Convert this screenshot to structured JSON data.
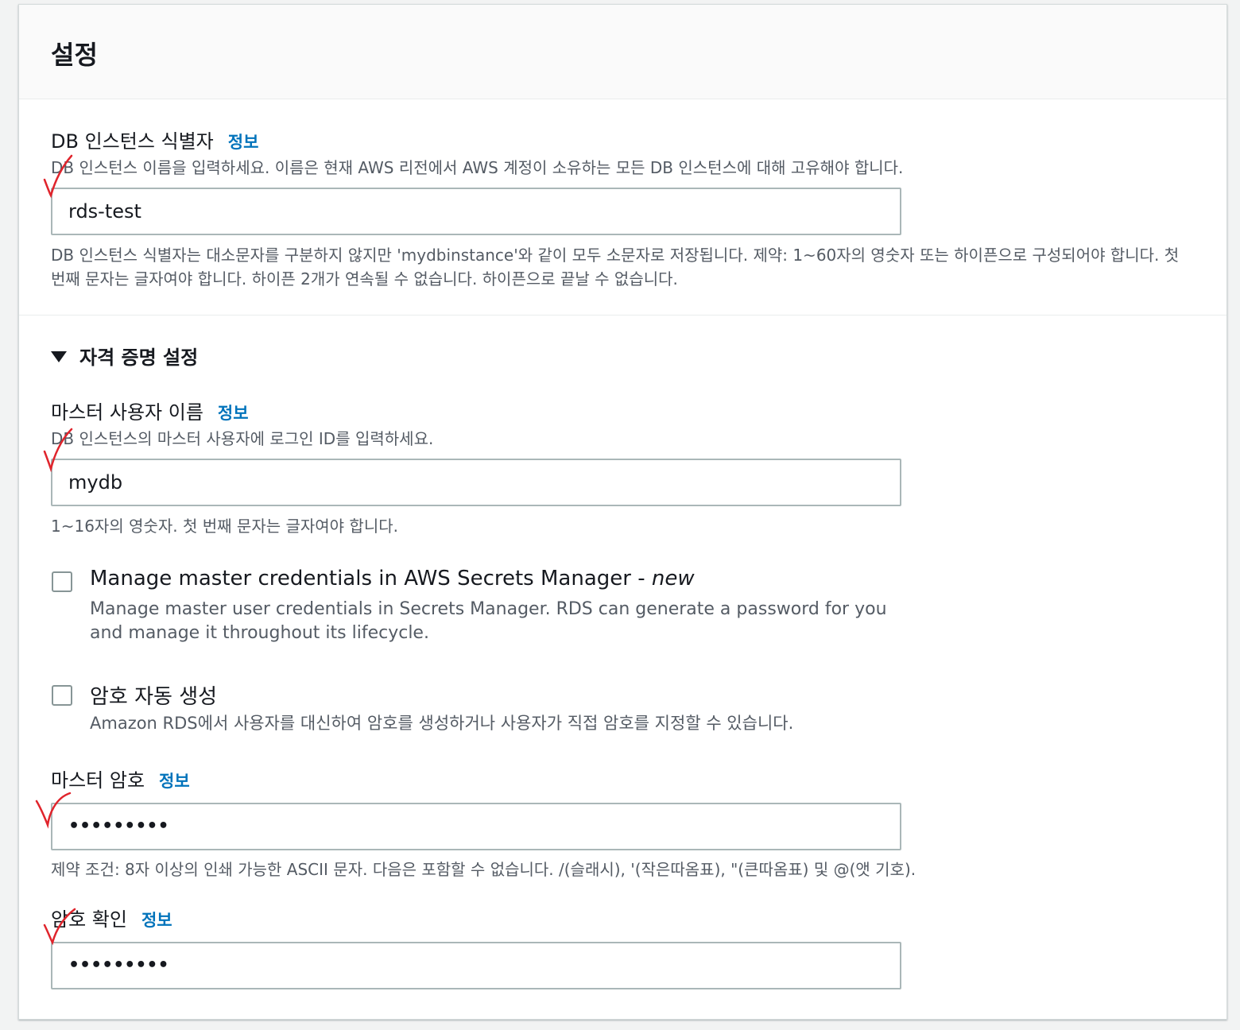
{
  "panel": {
    "title": "설정"
  },
  "db_identifier": {
    "label": "DB 인스턴스 식별자",
    "info": "정보",
    "description": "DB 인스턴스 이름을 입력하세요. 이름은 현재 AWS 리전에서 AWS 계정이 소유하는 모든 DB 인스턴스에 대해 고유해야 합니다.",
    "value": "rds-test",
    "constraint": "DB 인스턴스 식별자는 대소문자를 구분하지 않지만 'mydbinstance'와 같이 모두 소문자로 저장됩니다. 제약: 1~60자의 영숫자 또는 하이픈으로 구성되어야 합니다. 첫 번째 문자는 글자여야 합니다. 하이픈 2개가 연속될 수 없습니다. 하이픈으로 끝날 수 없습니다."
  },
  "credentials": {
    "section_title": "자격 증명 설정",
    "master_username": {
      "label": "마스터 사용자 이름",
      "info": "정보",
      "description": "DB 인스턴스의 마스터 사용자에 로그인 ID를 입력하세요.",
      "value": "mydb",
      "constraint": "1~16자의 영숫자. 첫 번째 문자는 글자여야 합니다."
    },
    "secrets_manager": {
      "label_main": "Manage master credentials in AWS Secrets Manager - ",
      "label_new": "new",
      "description": "Manage master user credentials in Secrets Manager. RDS can generate a password for you and manage it throughout its lifecycle.",
      "checked": false
    },
    "auto_password": {
      "label": "암호 자동 생성",
      "description": "Amazon RDS에서 사용자를 대신하여 암호를 생성하거나 사용자가 직접 암호를 지정할 수 있습니다.",
      "checked": false
    },
    "master_password": {
      "label": "마스터 암호",
      "info": "정보",
      "value": "•••••••••",
      "constraint": "제약 조건: 8자 이상의 인쇄 가능한 ASCII 문자. 다음은 포함할 수 없습니다. /(슬래시), '(작은따옴표), \"(큰따옴표) 및 @(앳 기호)."
    },
    "confirm_password": {
      "label": "암호 확인",
      "info": "정보",
      "value": "•••••••••"
    }
  },
  "colors": {
    "link": "#0073bb",
    "annotation_check": "#e0242c"
  }
}
